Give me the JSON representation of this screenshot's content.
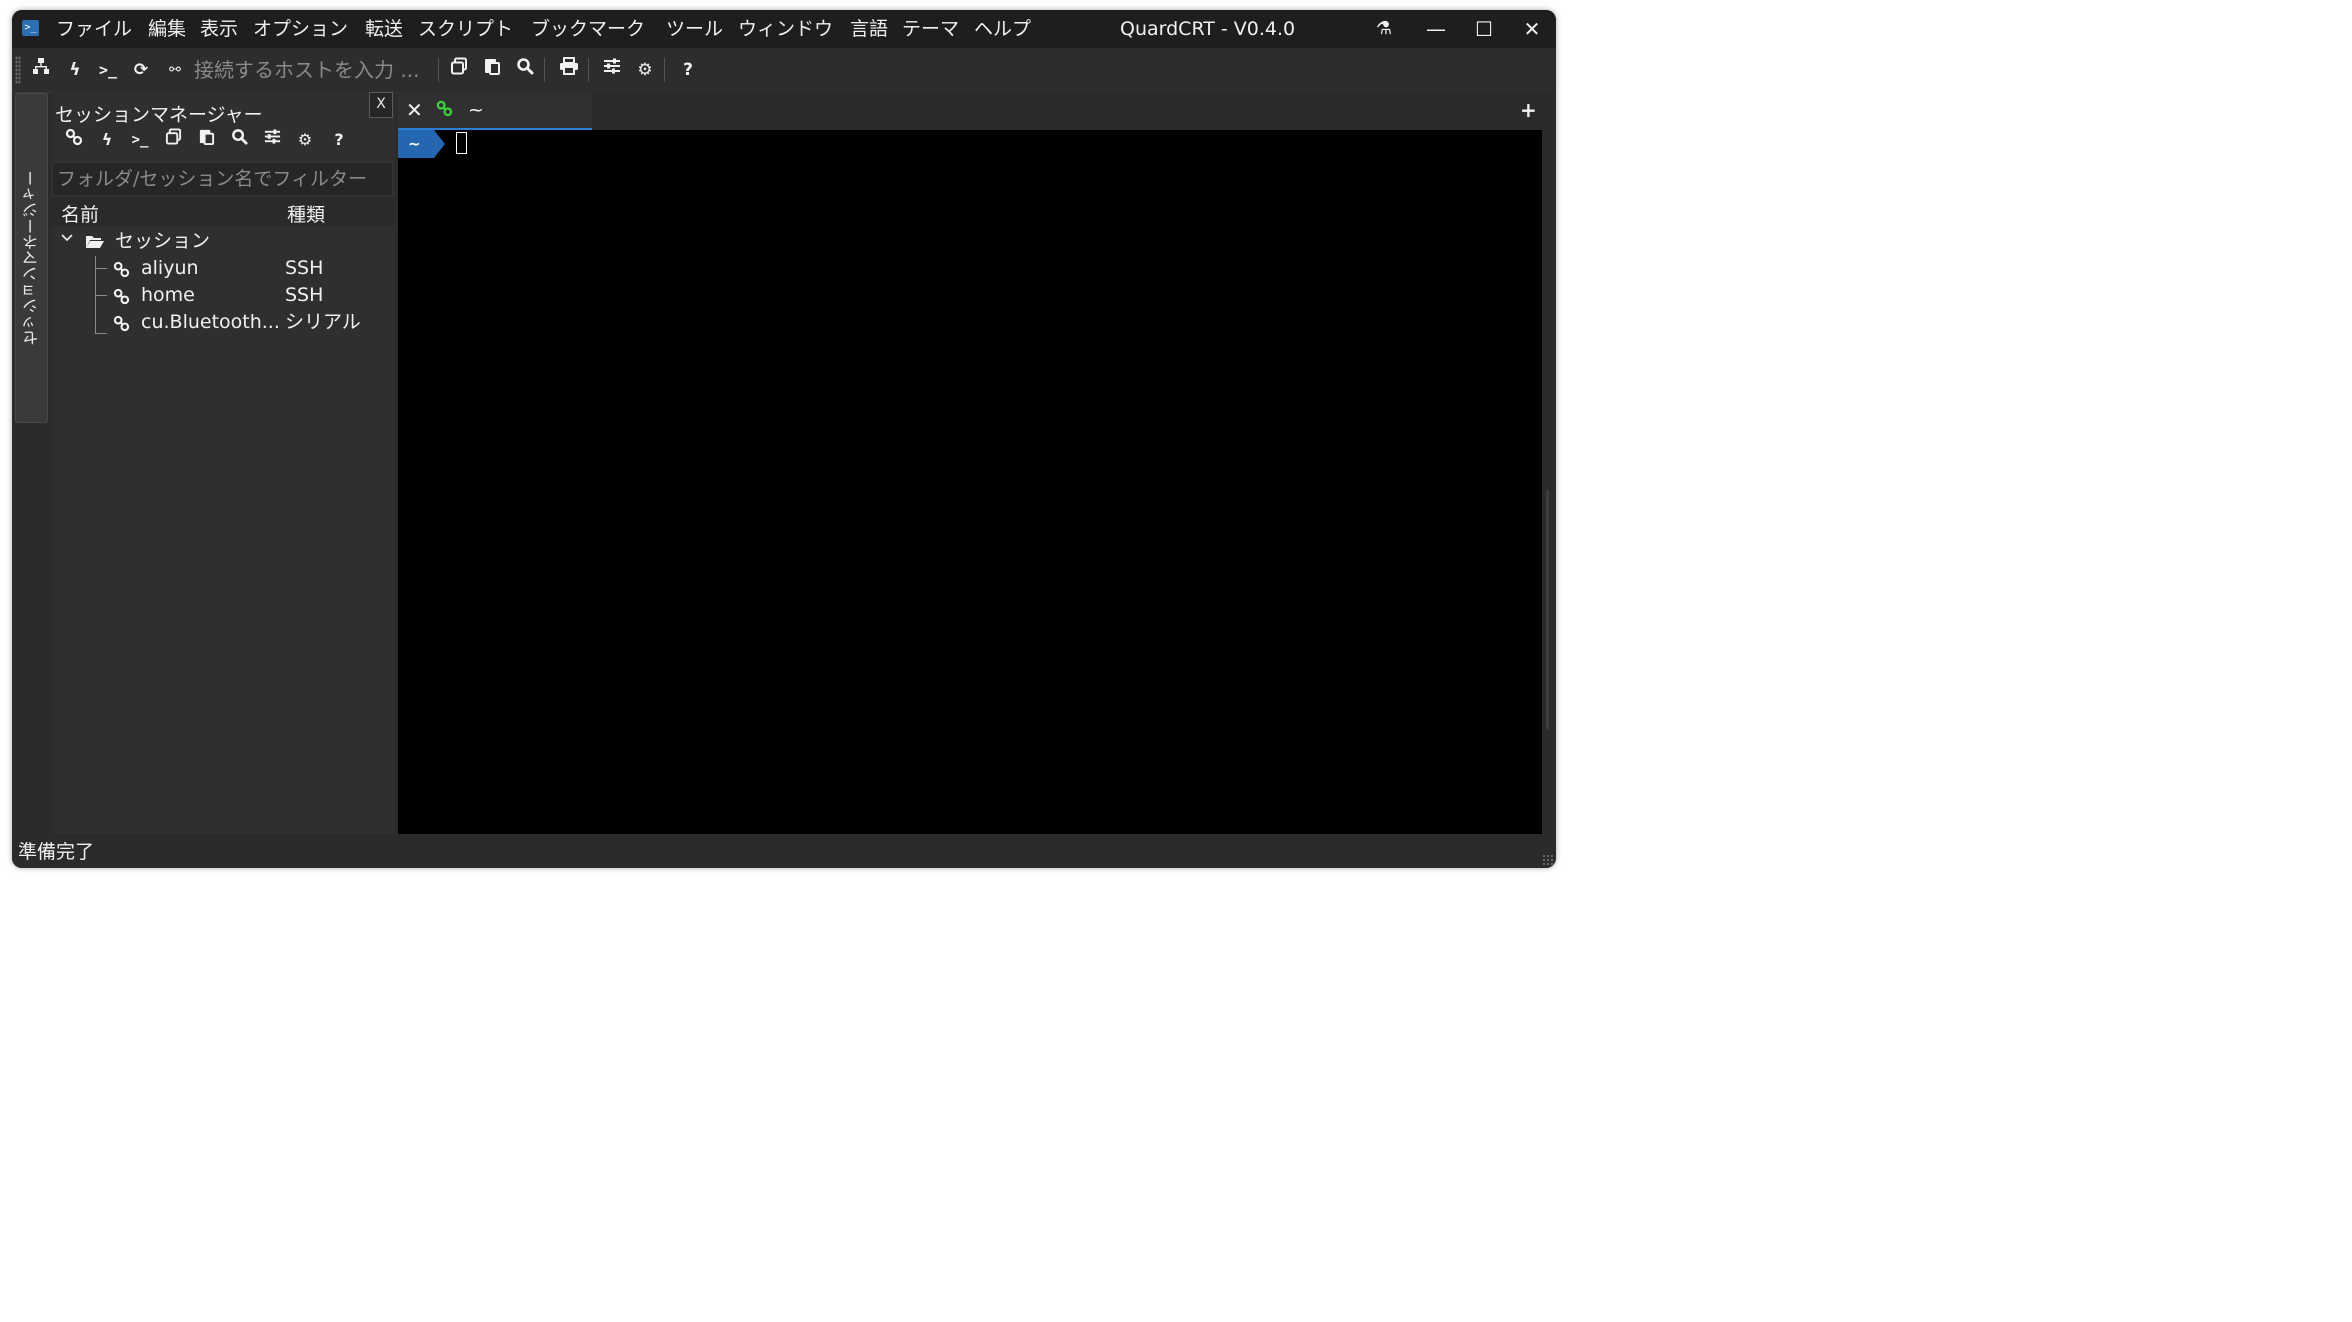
{
  "app": {
    "title": "QuardCRT - V0.4.0",
    "icon": "terminal-app-icon"
  },
  "menu": [
    "ファイル",
    "編集",
    "表示",
    "オプション",
    "転送",
    "スクリプト",
    "ブックマーク",
    "ツール",
    "ウィンドウ",
    "言語",
    "テーマ",
    "ヘルプ"
  ],
  "window_controls": {
    "lab": "⚗",
    "minimize": "—",
    "maximize": "☐",
    "close": "✕"
  },
  "toolbar": {
    "host_placeholder": "接続するホストを入力 ...",
    "icons": [
      "sitemap-icon",
      "lightning-icon",
      "terminal-prompt-icon",
      "refresh-icon",
      "disconnect-icon",
      "copy-icon",
      "paste-icon",
      "search-icon",
      "print-icon",
      "sliders-icon",
      "gear-icon",
      "help-icon"
    ]
  },
  "side_tab": {
    "label": "セッションマネージャー"
  },
  "session_manager": {
    "title": "セッションマネージャー",
    "close_label": "X",
    "filter_placeholder": "フォルダ/セッション名でフィルター",
    "columns": {
      "name": "名前",
      "type": "種類"
    },
    "folder": {
      "label": "セッション"
    },
    "sessions": [
      {
        "name": "aliyun",
        "type": "SSH"
      },
      {
        "name": "home",
        "type": "SSH"
      },
      {
        "name": "cu.Bluetooth...",
        "type": "シリアル"
      }
    ]
  },
  "terminal": {
    "tab_label": "~",
    "prompt": "~"
  },
  "status": {
    "text": "準備完了"
  },
  "colors": {
    "accent": "#2a7fd4",
    "link_green": "#3bd13b",
    "prompt_bg": "#2566b0"
  }
}
